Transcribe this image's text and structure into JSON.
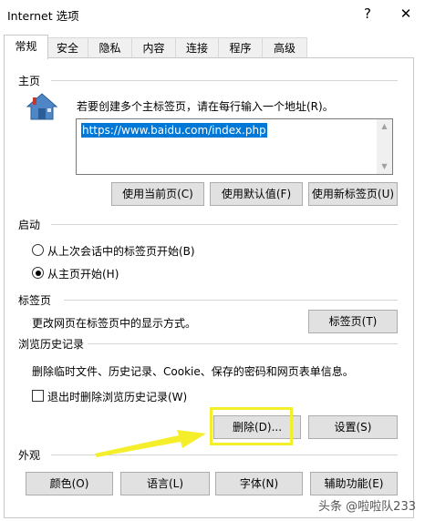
{
  "window": {
    "title": "Internet 选项",
    "help": "?",
    "close": "✕"
  },
  "tabs": [
    "常规",
    "安全",
    "隐私",
    "内容",
    "连接",
    "程序",
    "高级"
  ],
  "home": {
    "title": "主页",
    "instruction": "若要创建多个主标签页，请在每行输入一个地址(R)。",
    "url": "https://www.baidu.com/index.php",
    "buttons": [
      "使用当前页(C)",
      "使用默认值(F)",
      "使用新标签页(U)"
    ]
  },
  "startup": {
    "title": "启动",
    "options": [
      "从上次会话中的标签页开始(B)",
      "从主页开始(H)"
    ],
    "selected_index": 1
  },
  "tabsect": {
    "title": "标签页",
    "desc": "更改网页在标签页中的显示方式。",
    "button": "标签页(T)"
  },
  "history": {
    "title": "浏览历史记录",
    "desc": "删除临时文件、历史记录、Cookie、保存的密码和网页表单信息。",
    "checkbox_label": "退出时删除浏览历史记录(W)",
    "checkbox_checked": false,
    "delete_button": "删除(D)...",
    "settings_button": "设置(S)"
  },
  "appearance": {
    "title": "外观",
    "buttons": [
      "颜色(O)",
      "语言(L)",
      "字体(N)",
      "辅助功能(E)"
    ]
  },
  "watermark": "头条 @啦啦队233",
  "colors": {
    "selection": "#0078d7",
    "highlight": "#f5ee2a",
    "arrow": "#f5ee2a"
  }
}
